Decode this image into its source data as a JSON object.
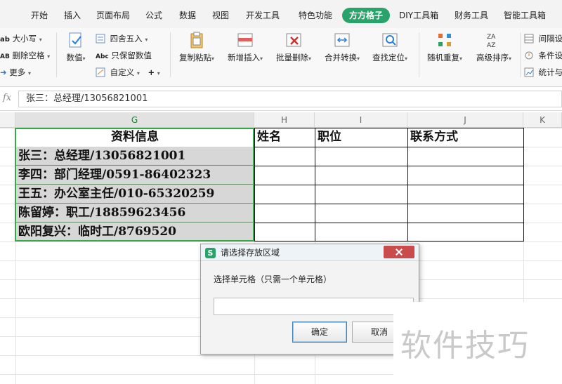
{
  "menu": {
    "tabs": [
      {
        "label": "开始"
      },
      {
        "label": "插入"
      },
      {
        "label": "页面布局"
      },
      {
        "label": "公式"
      },
      {
        "label": "数据"
      },
      {
        "label": "视图"
      },
      {
        "label": "开发工具"
      },
      {
        "label": "特色功能"
      },
      {
        "label": "方方格子"
      },
      {
        "label": "DIY工具箱"
      },
      {
        "label": "财务工具"
      },
      {
        "label": "智能工具箱"
      }
    ],
    "active_color": "#2aa36b"
  },
  "ribbon": {
    "case_label": "大小写",
    "delete_space_label": "删除空格",
    "more_label": "更多",
    "number_label": "数值",
    "round_label": "四舍五入",
    "keep_number_label": "只保留数值",
    "custom_label": "自定义",
    "paste_label": "复制粘贴",
    "insert_label": "新增插入",
    "batch_delete_label": "批量删除",
    "merge_label": "合并转换",
    "find_label": "查找定位",
    "random_label": "随机重复",
    "sort_label": "高级排序",
    "interval_label": "间隔设",
    "condition_label": "条件设",
    "stats_label": "统计与"
  },
  "formula_bar": {
    "fx": "fx",
    "content": "张三：总经理/13056821001"
  },
  "columns": {
    "G": "G",
    "H": "H",
    "I": "I",
    "J": "J",
    "K": "K"
  },
  "sheet": {
    "header_g": "资料信息",
    "header_h": "姓名",
    "header_i": "职位",
    "header_j": "联系方式",
    "rows": [
      "张三：总经理/13056821001",
      "李四：部门经理/0591-86402323",
      "王五：办公室主任/010-65320259",
      "陈留婷：职工/18859623456",
      "欧阳复兴：临时工/8769520"
    ]
  },
  "dialog": {
    "title": "请选择存放区域",
    "logo": "S",
    "label": "选择单元格（只需一个单元格）",
    "input_value": "",
    "ok_label": "确定",
    "cancel_label": "取消"
  },
  "watermark": {
    "text": "软件技巧"
  }
}
